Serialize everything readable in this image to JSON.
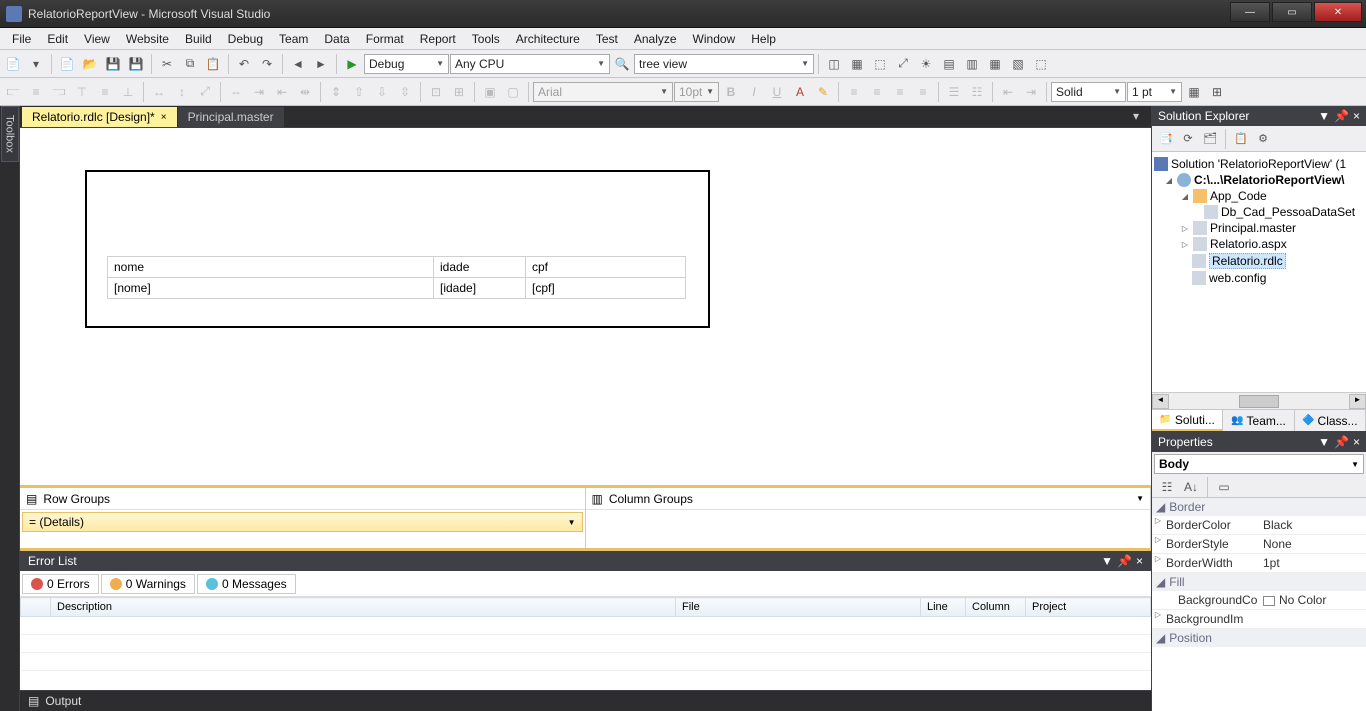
{
  "window": {
    "title": "RelatorioReportView - Microsoft Visual Studio"
  },
  "menu": [
    "File",
    "Edit",
    "View",
    "Website",
    "Build",
    "Debug",
    "Team",
    "Data",
    "Format",
    "Report",
    "Tools",
    "Architecture",
    "Test",
    "Analyze",
    "Window",
    "Help"
  ],
  "toolbar1": {
    "config": "Debug",
    "platform": "Any CPU",
    "search": "tree view"
  },
  "toolbar2": {
    "font": "Arial",
    "fontsize": "10pt",
    "borderStyle": "Solid",
    "borderWidth": "1 pt"
  },
  "tabs": [
    {
      "label": "Relatorio.rdlc [Design]*",
      "active": true
    },
    {
      "label": "Principal.master",
      "active": false
    }
  ],
  "toolbox_label": "Toolbox",
  "report": {
    "headers": [
      "nome",
      "idade",
      "cpf"
    ],
    "fields": [
      "[nome]",
      "[idade]",
      "[cpf]"
    ]
  },
  "groups": {
    "row_label": "Row Groups",
    "col_label": "Column Groups",
    "details": "(Details)"
  },
  "errorlist": {
    "title": "Error List",
    "errors": "0 Errors",
    "warnings": "0 Warnings",
    "messages": "0 Messages",
    "cols": [
      "Description",
      "File",
      "Line",
      "Column",
      "Project"
    ]
  },
  "output_tab": "Output",
  "solexp": {
    "title": "Solution Explorer",
    "sln": "Solution 'RelatorioReportView' (1",
    "proj": "C:\\...\\RelatorioReportView\\",
    "appcode": "App_Code",
    "dataset": "Db_Cad_PessoaDataSet",
    "master": "Principal.master",
    "aspx": "Relatorio.aspx",
    "rdlc": "Relatorio.rdlc",
    "config": "web.config"
  },
  "btm_tabs": [
    "Soluti...",
    "Team...",
    "Class..."
  ],
  "props": {
    "title": "Properties",
    "object": "Body",
    "cats": {
      "border": "Border",
      "fill": "Fill",
      "position": "Position"
    },
    "rows": {
      "BorderColor": "Black",
      "BorderStyle": "None",
      "BorderWidth": "1pt",
      "BackgroundColor_key": "BackgroundCo",
      "BackgroundColor_val": "No Color",
      "BackgroundImage": "BackgroundIm"
    }
  }
}
